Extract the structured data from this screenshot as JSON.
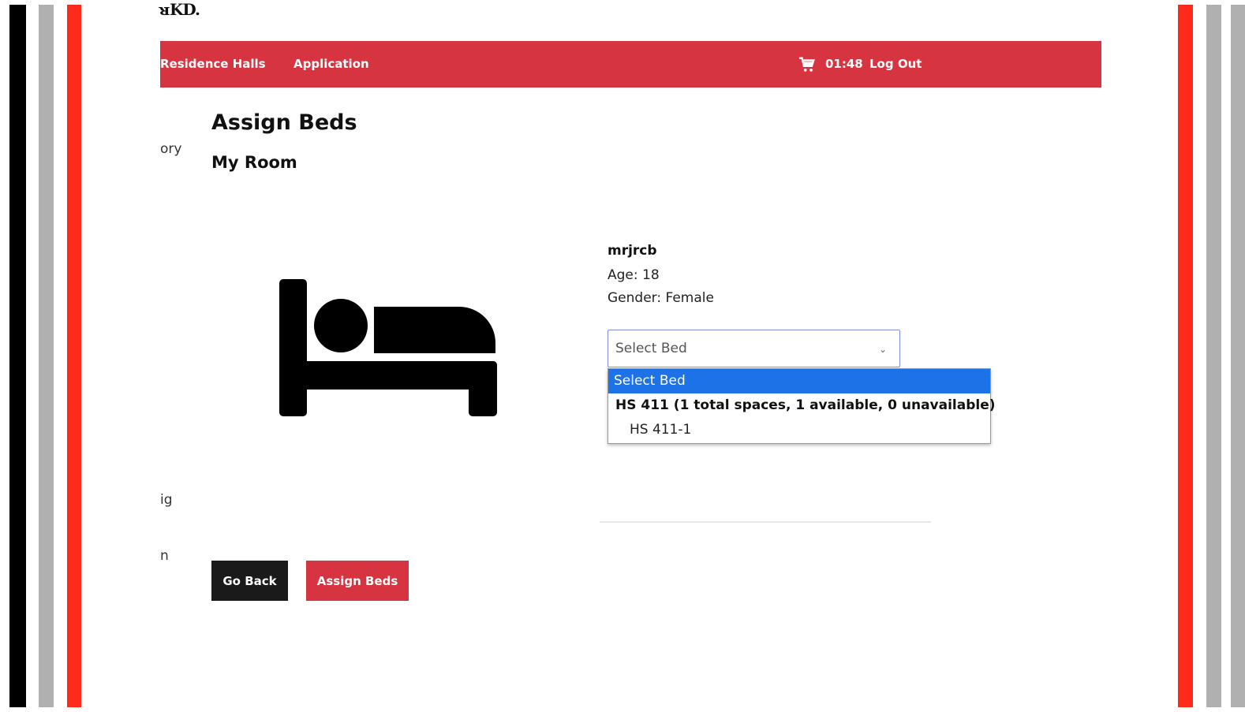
{
  "brand": {
    "logo_text": "ᴚKD.",
    "accent_color": "#d63440",
    "stripe_colors": {
      "black": "#000000",
      "gray": "#b0b0b0",
      "red": "#ff2a1a"
    }
  },
  "nav": {
    "items": [
      "Residence Halls",
      "Application"
    ],
    "timer": "01:48",
    "logout_label": "Log Out",
    "cart_icon": "cart-icon"
  },
  "sidebar_fragments": [
    "ory",
    "ig",
    "n"
  ],
  "page": {
    "title": "Assign Beds",
    "subtitle": "My Room",
    "image_icon": "bed-icon"
  },
  "user": {
    "name": "mrjrcb",
    "age_label": "Age: 18",
    "gender_label": "Gender: Female"
  },
  "bed_select": {
    "value": "Select Bed",
    "options": {
      "placeholder": "Select Bed",
      "group_label": "HS 411 (1 total spaces, 1 available, 0 unavailable)",
      "items": [
        "HS 411-1"
      ]
    }
  },
  "buttons": {
    "go_back": "Go Back",
    "assign_beds": "Assign Beds"
  }
}
